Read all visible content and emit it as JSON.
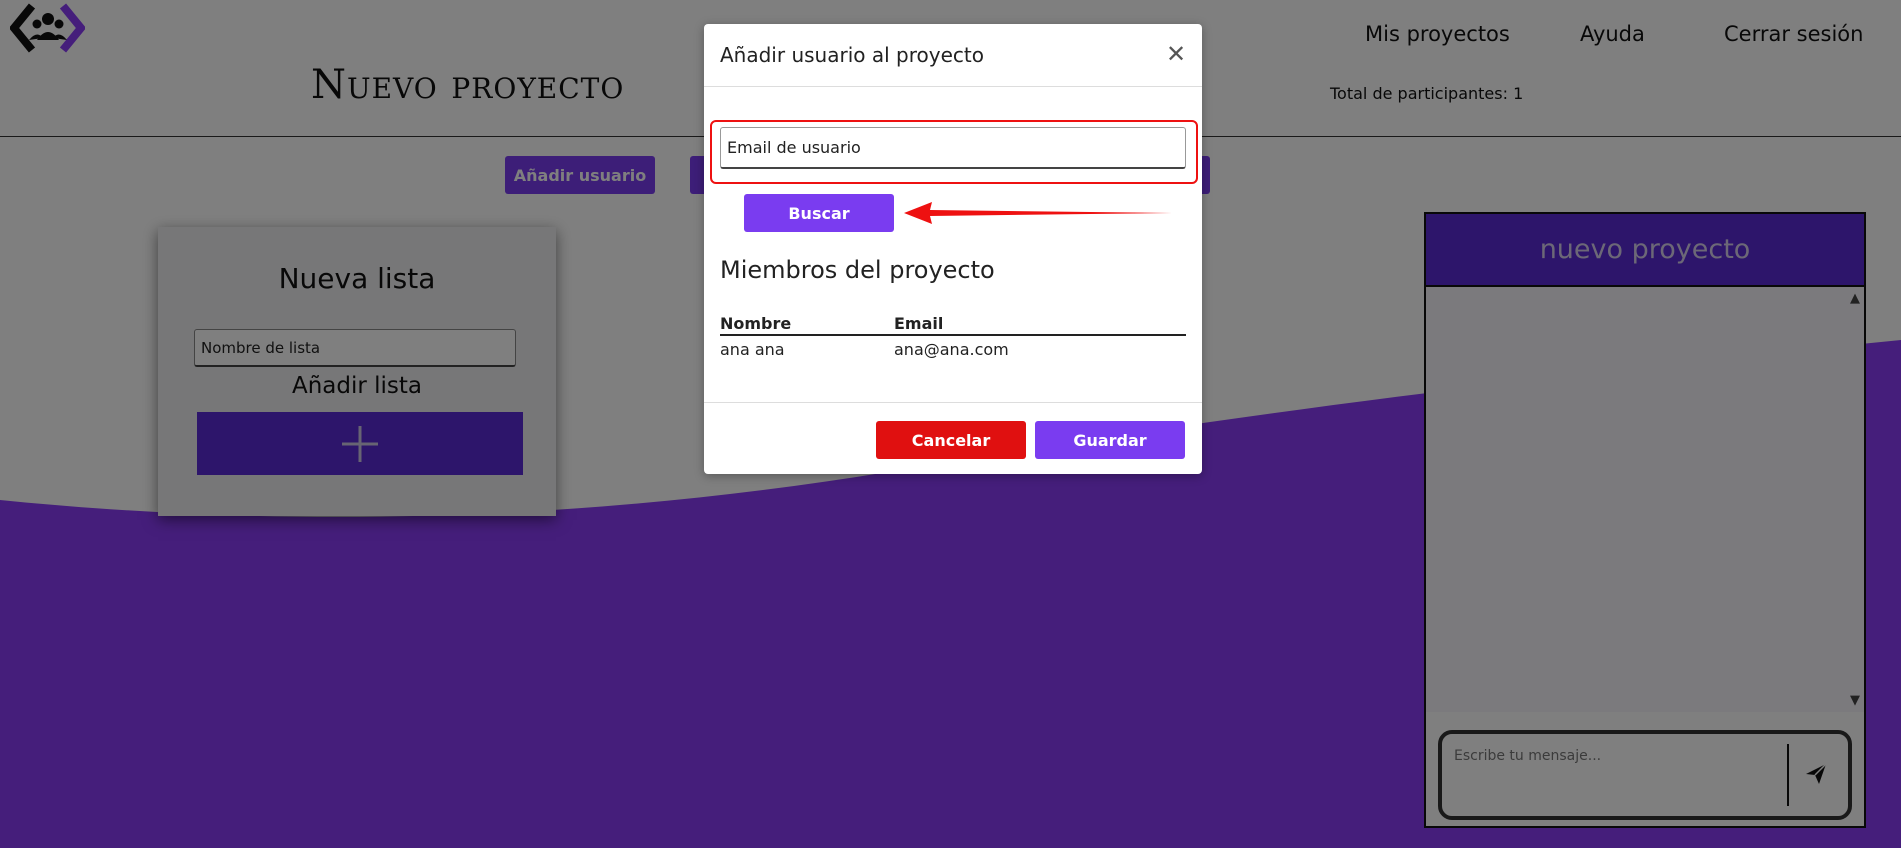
{
  "nav": {
    "my_projects": "Mis proyectos",
    "help": "Ayuda",
    "logout": "Cerrar sesión"
  },
  "page": {
    "title": "Nuevo proyecto",
    "participants": "Total de participantes: 1",
    "add_user_button": "Añadir usuario"
  },
  "list_card": {
    "title": "Nueva lista",
    "name_placeholder": "Nombre de lista",
    "add_label": "Añadir lista"
  },
  "chat": {
    "title": "nuevo proyecto",
    "message_placeholder": "Escribe tu mensaje..."
  },
  "modal": {
    "title": "Añadir usuario al proyecto",
    "email_placeholder": "Email de usuario",
    "search_button": "Buscar",
    "members_title": "Miembros del proyecto",
    "columns": [
      "Nombre",
      "Email"
    ],
    "members": [
      {
        "name": "ana ana",
        "email": "ana@ana.com"
      }
    ],
    "cancel_button": "Cancelar",
    "save_button": "Guardar"
  },
  "colors": {
    "accent": "#7a3cf0",
    "brand_dark": "#5b2ad6",
    "danger": "#e01010",
    "highlight": "#e11111"
  }
}
